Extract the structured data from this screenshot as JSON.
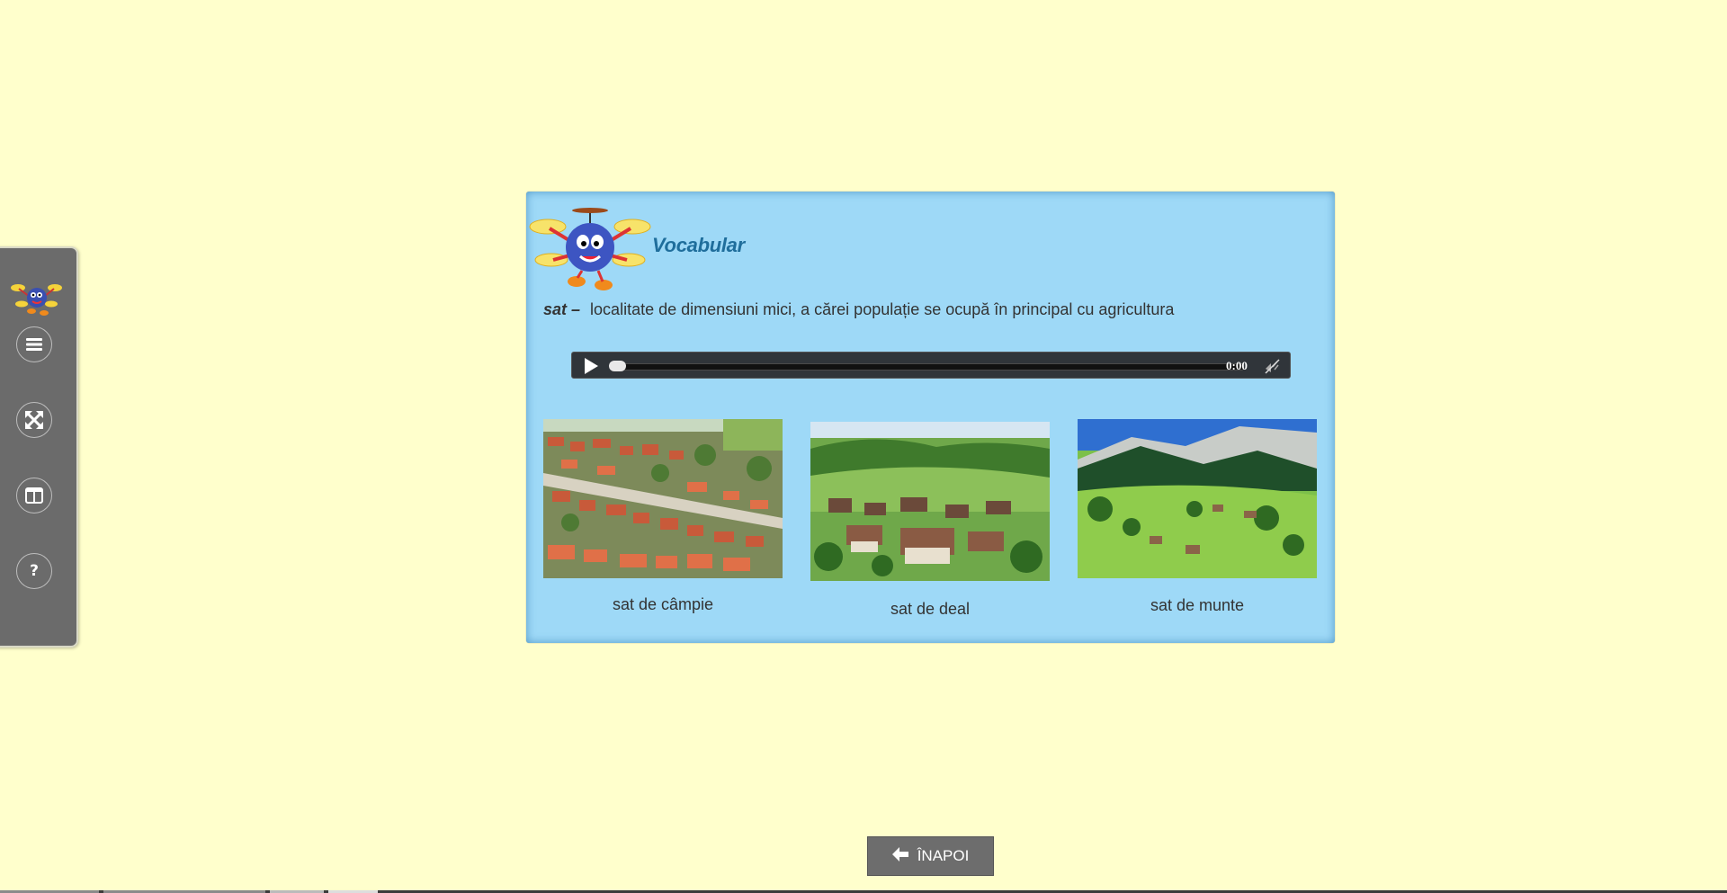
{
  "sidebar": {
    "logo_icon": "drone-mascot-icon",
    "buttons": [
      {
        "icon": "menu-icon"
      },
      {
        "icon": "fullscreen-icon"
      },
      {
        "icon": "layout-icon"
      },
      {
        "icon": "help-icon",
        "label": "?"
      }
    ]
  },
  "card": {
    "title": "Vocabular",
    "mascot_icon": "drone-mascot-icon",
    "definition": {
      "term": "sat –",
      "text": "localitate de dimensiuni mici, a cărei populație se ocupă în principal cu agricultura"
    },
    "audio": {
      "time": "0:00",
      "progress": 0,
      "play_icon": "play-icon",
      "volume_icon": "mute-icon"
    },
    "photos": [
      {
        "caption": "sat de câmpie"
      },
      {
        "caption": "sat de deal"
      },
      {
        "caption": "sat de munte"
      }
    ]
  },
  "nav": {
    "back_label": "ÎNAPOI",
    "back_icon": "arrow-left-icon"
  },
  "colors": {
    "page_bg": "#ffffcc",
    "card_bg": "#9ed9f7",
    "title": "#1f6e9c",
    "sidebar_bg": "#6b6b6b"
  }
}
